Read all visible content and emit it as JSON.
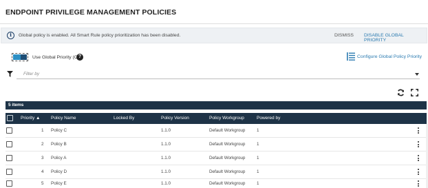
{
  "page": {
    "title": "ENDPOINT PRIVILEGE MANAGEMENT POLICIES"
  },
  "banner": {
    "icon": "info-circle-icon",
    "message": "Global policy is enabled. All Smart Rule policy prioritization has been disabled.",
    "dismiss_label": "DISMISS",
    "disable_label": "DISABLE GLOBAL PRIORITY"
  },
  "global_priority": {
    "toggle_state": "on",
    "label": "Use Global Priority (On)",
    "help_icon": "question-circle-icon",
    "configure_label": "Configure Global Policy Priority",
    "configure_icon": "priority-list-icon"
  },
  "filter": {
    "placeholder": "Filter by",
    "icon": "funnel-icon"
  },
  "toolbar": {
    "refresh_icon": "refresh-icon",
    "fullscreen_icon": "fullscreen-icon"
  },
  "table": {
    "item_count": "5 items",
    "sort_indicator": "▲",
    "columns": {
      "priority": "Priority",
      "name": "Policy Name",
      "locked_by": "Locked By",
      "version": "Policy Version",
      "workgroup": "Policy Workgroup",
      "powered_by": "Powered by"
    },
    "rows": [
      {
        "priority": "1",
        "name": "Policy C",
        "locked_by": "",
        "version": "1.1.0",
        "workgroup": "Default Workgroup",
        "powered_by": "1"
      },
      {
        "priority": "2",
        "name": "Policy B",
        "locked_by": "",
        "version": "1.1.0",
        "workgroup": "Default Workgroup",
        "powered_by": "1"
      },
      {
        "priority": "3",
        "name": "Policy A",
        "locked_by": "",
        "version": "1.1.0",
        "workgroup": "Default Workgroup",
        "powered_by": "1"
      },
      {
        "priority": "4",
        "name": "Policy D",
        "locked_by": "",
        "version": "1.1.0",
        "workgroup": "Default Workgroup",
        "powered_by": "1"
      },
      {
        "priority": "5",
        "name": "Policy E",
        "locked_by": "",
        "version": "1.1.0",
        "workgroup": "Default Workgroup",
        "powered_by": "1"
      }
    ]
  },
  "colors": {
    "header_bg": "#1e3347",
    "link": "#2a7ab0",
    "toggle_on": "#2d8fc4",
    "banner_bg": "#eef1f4"
  }
}
